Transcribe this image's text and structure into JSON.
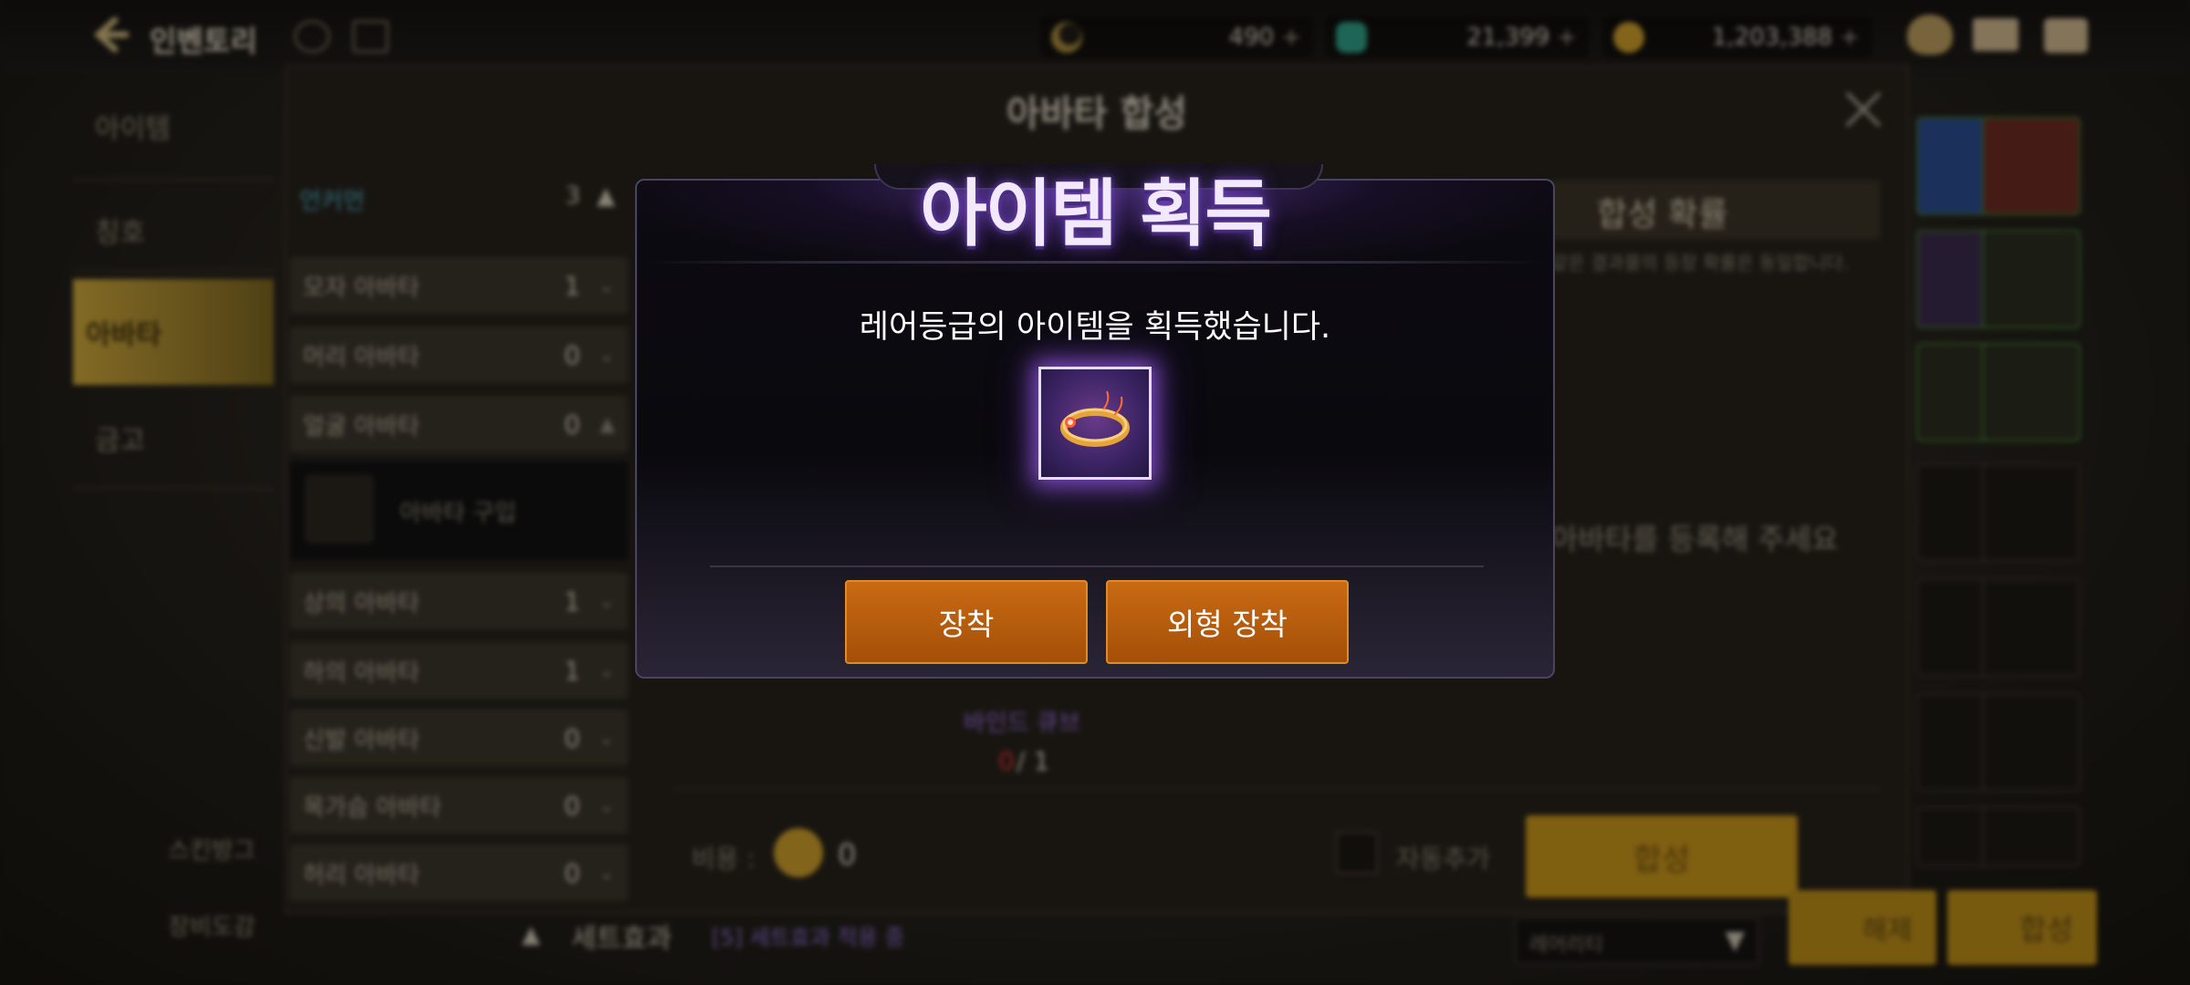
{
  "header": {
    "back_title": "인벤토리",
    "currencies": [
      {
        "icon": "crescent-coin-icon",
        "value": "490"
      },
      {
        "icon": "green-gem-icon",
        "value": "21,399"
      },
      {
        "icon": "gold-coin-icon",
        "value": "1,203,388"
      }
    ],
    "plus_symbol": "+"
  },
  "sidebar": {
    "items": [
      {
        "label": "아이템"
      },
      {
        "label": "칭호"
      },
      {
        "label": "아바타"
      },
      {
        "label": "금고"
      }
    ],
    "bottom_items": [
      {
        "label": "스킨방그"
      },
      {
        "label": "장비도감"
      }
    ]
  },
  "panel": {
    "title": "아바타 합성",
    "category_group": {
      "label": "언커먼",
      "count": "3",
      "chevron": "▲"
    },
    "categories": [
      {
        "label": "모자 아바타",
        "count": "1",
        "chevron": "⌄"
      },
      {
        "label": "머리 아바타",
        "count": "0",
        "chevron": "⌄"
      },
      {
        "label": "얼굴 아바타",
        "count": "0",
        "chevron": "▲"
      },
      {
        "label": "상의 아바타",
        "count": "1",
        "chevron": "⌄"
      },
      {
        "label": "하의 아바타",
        "count": "1",
        "chevron": "⌄"
      },
      {
        "label": "신발 아바타",
        "count": "0",
        "chevron": "⌄"
      },
      {
        "label": "목가슴 아바타",
        "count": "0",
        "chevron": "⌄"
      },
      {
        "label": "허리 아바타",
        "count": "0",
        "chevron": "⌄"
      }
    ],
    "sub_item_label": "아바타 구입",
    "synthesis_rate_label": "합성 확률",
    "rate_note": "같은 결과물의 등장 확률은 동일합니다.",
    "register_hint": "아바타를 등록해 주세요",
    "bind_cube_label": "바인드 큐브",
    "bind_cube_have": "0",
    "bind_cube_need": "/ 1",
    "cost_label": "비용 :",
    "cost_value": "0",
    "auto_add_label": "자동추가",
    "synth_button": "합성",
    "set_effect_label": "세트효과",
    "set_effect_value": "[5] 세트효과 적용 중",
    "rarity_select": "레어리티",
    "bottom_btn1": "해제",
    "bottom_btn2": "합성"
  },
  "modal": {
    "title": "아이템 획득",
    "message": "레어등급의 아이템을 획득했습니다.",
    "item_icon": "ring-icon",
    "equip_button": "장착",
    "appearance_equip_button": "외형 장착"
  },
  "colors": {
    "accent_orange": "#b35a0c",
    "gold": "#c4921a",
    "rare_purple": "#7a4bd1"
  }
}
